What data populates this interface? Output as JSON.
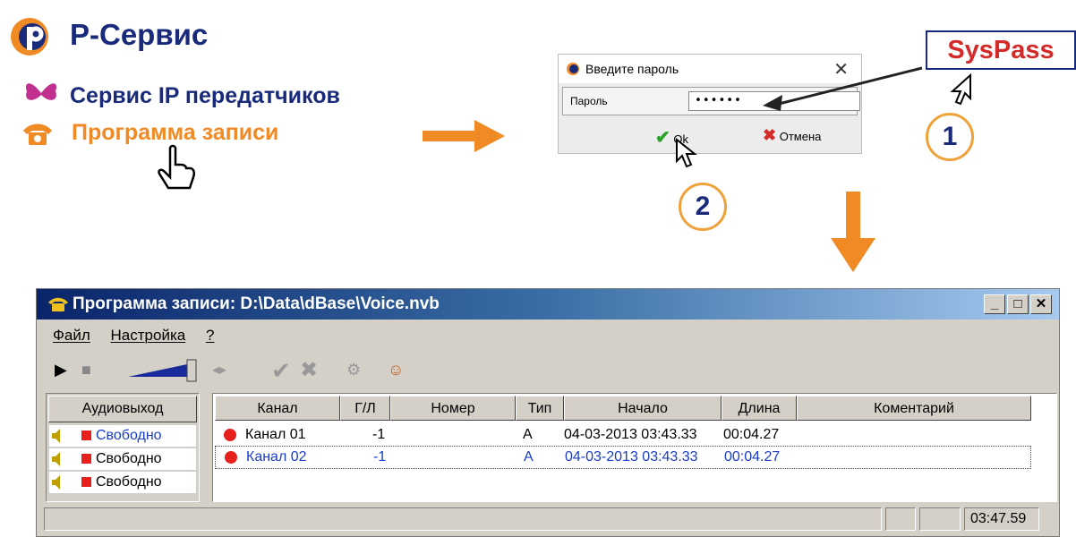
{
  "brand": {
    "title": "P-Сервис"
  },
  "menu": {
    "item1": "Сервис IP передатчиков",
    "item2": "Программа записи"
  },
  "dialog": {
    "title": "Введите пароль",
    "close": "✕",
    "field_label": "Пароль",
    "field_value": "••••••",
    "ok_label": "Ok",
    "cancel_label": "Отмена"
  },
  "callout": {
    "syspass": "SysPass",
    "step1": "1",
    "step2": "2"
  },
  "window": {
    "title": "Программа записи: D:\\Data\\dBase\\Voice.nvb",
    "min": "_",
    "max": "□",
    "close": "✕",
    "menu": [
      "Файл",
      "Настройка",
      "?"
    ],
    "audio": {
      "header": "Аудиовыход",
      "rows": [
        "Свободно",
        "Свободно",
        "Свободно"
      ]
    },
    "grid": {
      "columns": [
        "Канал",
        "Г/Л",
        "Номер",
        "Тип",
        "Начало",
        "Длина",
        "Коментарий"
      ],
      "rows": [
        {
          "channel": "Канал 01",
          "gl": "-1",
          "number": "",
          "type": "A",
          "start": "04-03-2013 03:43.33",
          "length": "00:04.27",
          "comment": ""
        },
        {
          "channel": "Канал 02",
          "gl": "-1",
          "number": "",
          "type": "A",
          "start": "04-03-2013 03:43.33",
          "length": "00:04.27",
          "comment": ""
        }
      ]
    },
    "status_time": "03:47.59"
  },
  "colors": {
    "navy": "#1a2a7a",
    "orange": "#f08a24",
    "red": "#d42a2a",
    "selected_text": "#1a3cc8"
  }
}
